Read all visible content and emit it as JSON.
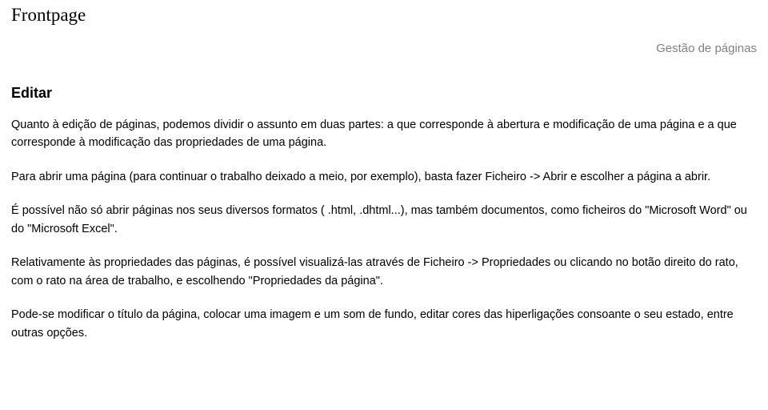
{
  "header": {
    "title": "Frontpage",
    "right_label": "Gestão de páginas"
  },
  "section": {
    "heading": "Editar",
    "paragraphs": [
      "Quanto à edição de páginas, podemos dividir o assunto em duas partes: a que corresponde à abertura e modificação de uma página e a que corresponde à modificação das propriedades de uma página.",
      "Para abrir uma página (para continuar o trabalho deixado a meio, por exemplo), basta fazer Ficheiro -> Abrir e escolher a página a abrir.",
      "É possível não só abrir páginas nos seus diversos formatos ( .html, .dhtml...), mas também documentos, como ficheiros do \"Microsoft Word\" ou do \"Microsoft Excel\".",
      "Relativamente às propriedades das páginas, é possível visualizá-las através de Ficheiro -> Propriedades ou clicando no botão direito do rato, com o rato na área de trabalho, e escolhendo \"Propriedades da página\".",
      "Pode-se modificar o título da página, colocar uma imagem e um som de fundo, editar cores das hiperligações consoante o seu estado, entre outras opções."
    ]
  }
}
